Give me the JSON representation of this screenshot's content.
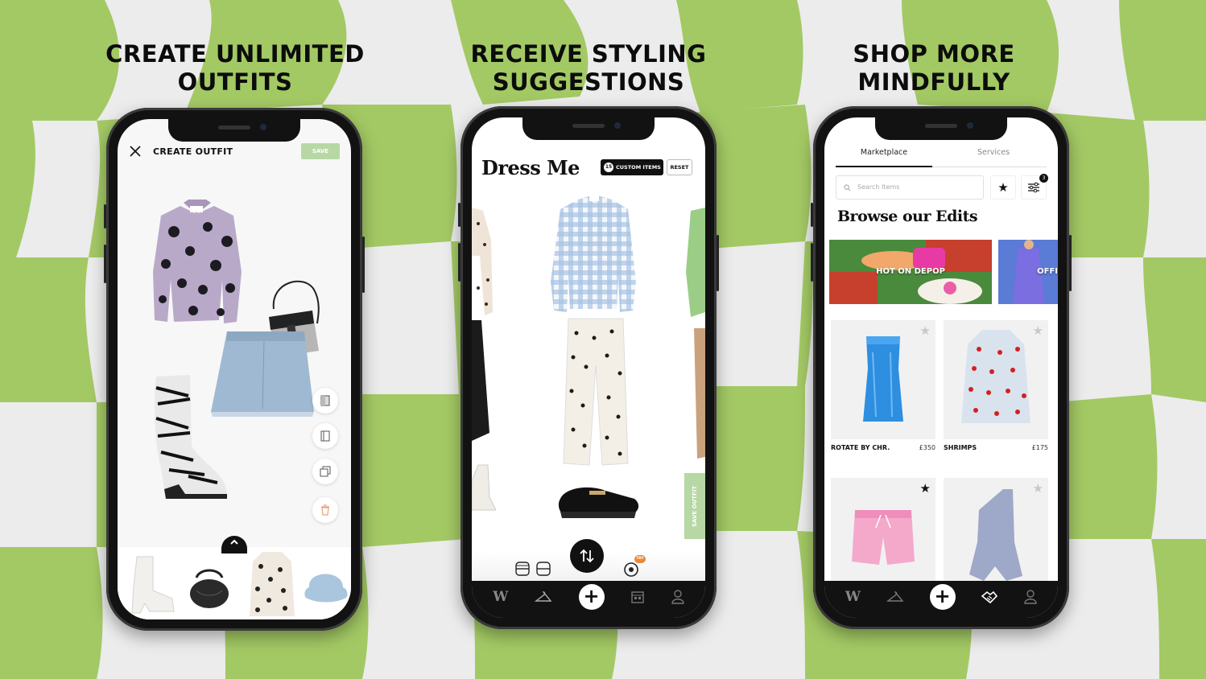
{
  "colors": {
    "background_light": "#e9e9e9",
    "background_green": "#a3c964",
    "accent_green": "#b7d8a4",
    "phone_black": "#121212"
  },
  "headlines": [
    {
      "line1": "CREATE UNLIMITED",
      "line2": "OUTFITS"
    },
    {
      "line1": "RECEIVE STYLING",
      "line2": "SUGGESTIONS"
    },
    {
      "line1": "SHOP MORE",
      "line2": "MINDFULLY"
    }
  ],
  "create_outfit": {
    "title": "CREATE OUTFIT",
    "save_label": "SAVE",
    "close_icon": "close-icon",
    "tools": [
      "layer-front-icon",
      "layer-back-icon",
      "duplicate-icon",
      "trash-icon"
    ],
    "canvas_items": [
      "purple-polka-dot-coat",
      "clear-bucket-bag",
      "denim-mini-skirt",
      "zebra-cowboy-boot"
    ],
    "tray_items": [
      "white-platform-boot",
      "black-ruched-bag",
      "heart-print-coat",
      "blue-fuzzy-hat"
    ]
  },
  "dress_me": {
    "logo": "Dress Me",
    "custom_items_count": "15",
    "custom_items_label": "CUSTOM ITEMS",
    "reset_label": "RESET",
    "save_outfit_label": "SAVE OUTFIT",
    "try_badge": "TRY",
    "outfit_items": [
      "blue-gingham-fur-jacket",
      "polka-dot-trousers",
      "black-loafers"
    ]
  },
  "marketplace": {
    "tabs": [
      {
        "label": "Marketplace",
        "active": true
      },
      {
        "label": "Services",
        "active": false
      }
    ],
    "search_placeholder": "Search Items",
    "filter_count": "3",
    "heading": "Browse our Edits",
    "edits": [
      {
        "label": "HOT ON DEPOP"
      },
      {
        "label": "OFFI"
      }
    ],
    "products": [
      {
        "brand": "ROTATE BY CHR.",
        "price": "£350",
        "favorited": false,
        "item": "blue-strapless-dress"
      },
      {
        "brand": "SHRIMPS",
        "price": "£175",
        "favorited": false,
        "item": "heart-print-coat"
      },
      {
        "brand": "",
        "price": "",
        "favorited": true,
        "item": "pink-shorts"
      },
      {
        "brand": "",
        "price": "",
        "favorited": false,
        "item": "one-shoulder-bodysuit"
      }
    ]
  },
  "nav": {
    "items": [
      "wardrobe-logo-icon",
      "hanger-icon",
      "plus-icon",
      "calendar-icon",
      "profile-icon"
    ],
    "marketplace_items": [
      "wardrobe-logo-icon",
      "hanger-icon",
      "plus-icon",
      "handshake-icon",
      "profile-icon"
    ],
    "logo_letter": "W",
    "plus": "+"
  }
}
